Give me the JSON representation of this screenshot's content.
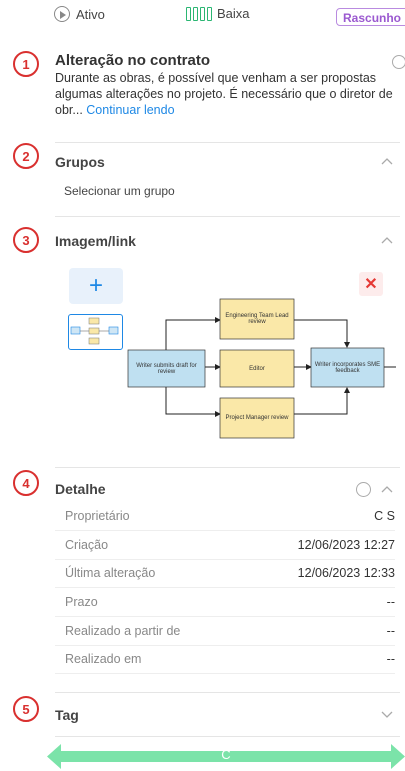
{
  "status": {
    "state_label": "Ativo",
    "priority_label": "Baixa",
    "badge_label": "Rascunho",
    "badge_color": "#9b59d0",
    "priority_color": "#2bb673"
  },
  "markers": [
    "1",
    "2",
    "3",
    "4",
    "5"
  ],
  "section1": {
    "title": "Alteração no contrato",
    "description": "Durante as obras, é possível que venham a ser propostas algumas alterações no projeto. É necessário que o diretor de obr...",
    "read_more": "Continuar lendo"
  },
  "section2": {
    "title": "Grupos",
    "subtitle": "Selecionar um grupo"
  },
  "section3": {
    "title": "Imagem/link",
    "add_label": "+",
    "close_label": "✕",
    "diagram": {
      "start": "Writer submits draft for review",
      "top": "Engineering Team Lead review",
      "middle": "Editor",
      "bottom": "Project Manager review",
      "end": "Writer incorporates SME feedback"
    }
  },
  "section4": {
    "title": "Detalhe",
    "rows": [
      {
        "label": "Proprietário",
        "value": "C S"
      },
      {
        "label": "Criação",
        "value": "12/06/2023 12:27"
      },
      {
        "label": "Última alteração",
        "value": "12/06/2023 12:33"
      },
      {
        "label": "Prazo",
        "value": "--"
      },
      {
        "label": "Realizado a partir de",
        "value": "--"
      },
      {
        "label": "Realizado em",
        "value": "--"
      }
    ]
  },
  "section5": {
    "title": "Tag"
  },
  "bottom": {
    "label": "C",
    "color": "#7be3a9"
  }
}
